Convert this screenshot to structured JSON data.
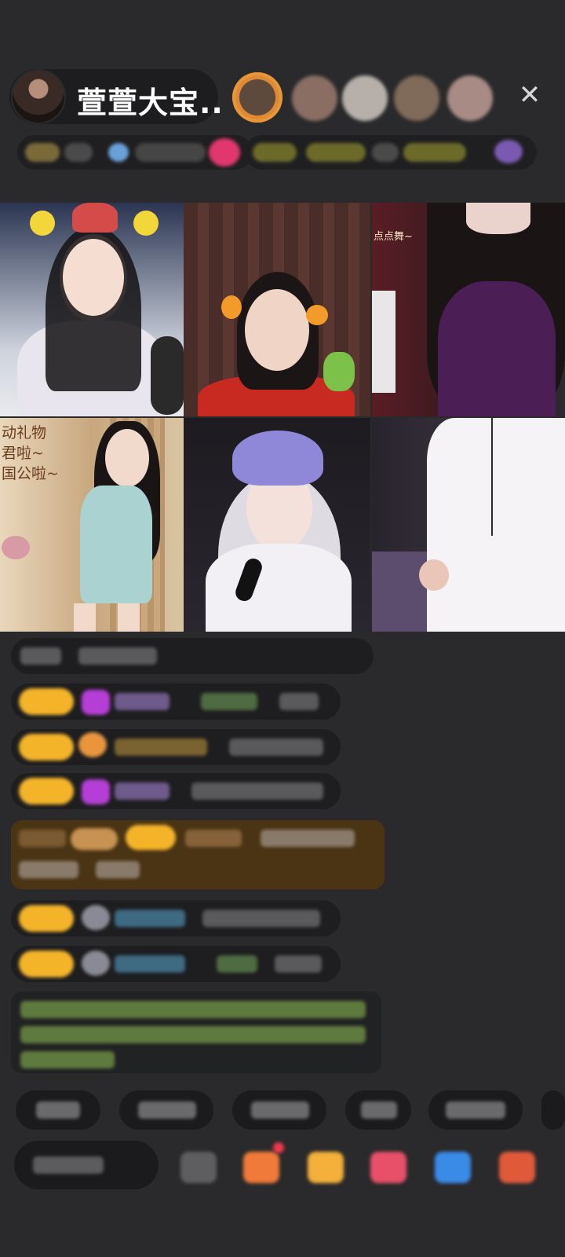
{
  "header": {
    "host_name": "萱萱大宝...",
    "close_icon": "close-icon"
  },
  "grid": {
    "cells": [
      {
        "id": "top-left"
      },
      {
        "id": "top-middle"
      },
      {
        "id": "top-right",
        "overlay_text": "点点舞~"
      },
      {
        "id": "bottom-left",
        "overlay_text": "动礼物\n君啦~\n国公啦~"
      },
      {
        "id": "bottom-middle"
      },
      {
        "id": "bottom-right"
      }
    ]
  },
  "colors": {
    "background": "#2a2a2c",
    "badge": "#f4b42a",
    "system_box": "#4a3414",
    "green_text": "#86b95a"
  }
}
